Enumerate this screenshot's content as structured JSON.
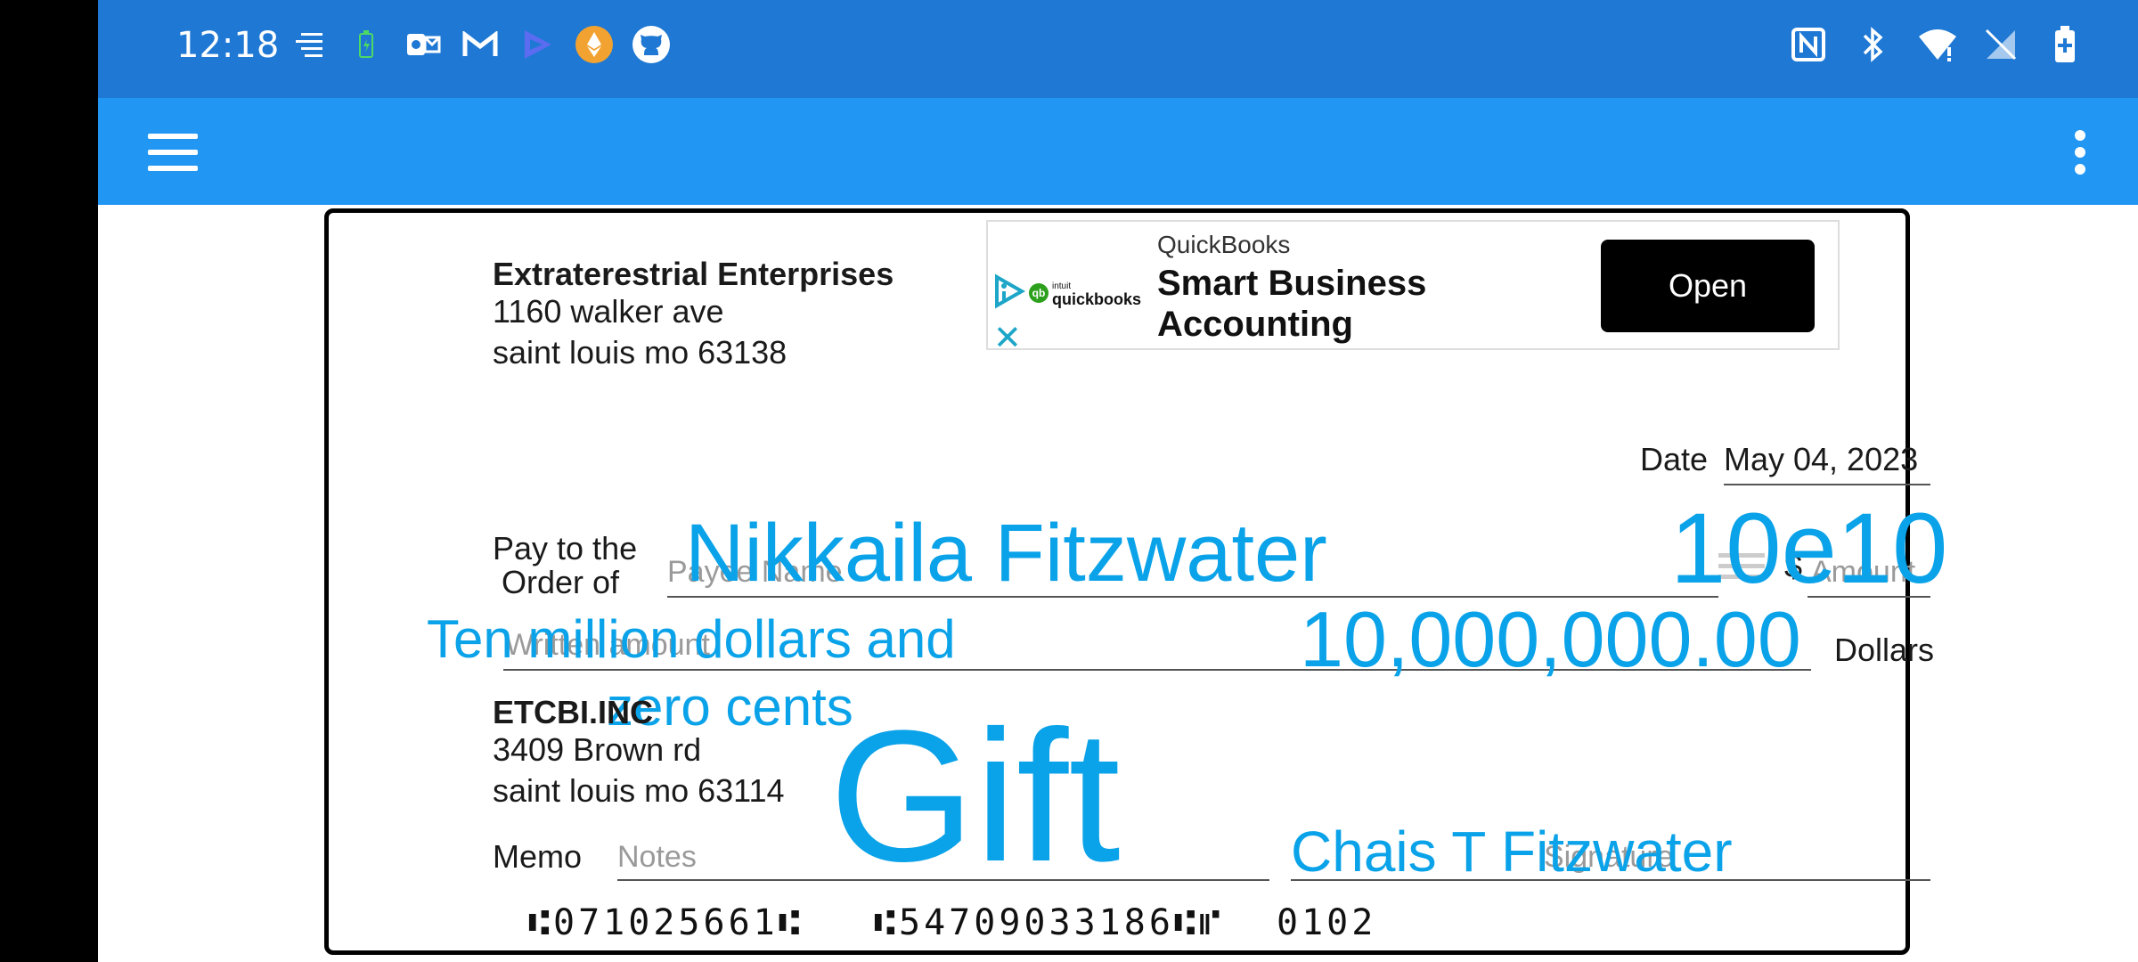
{
  "status_bar": {
    "time": "12:18",
    "left_icons": [
      "news-icon",
      "battery-saver-icon",
      "outlook-icon",
      "gmail-icon",
      "app-icon",
      "ethereum-icon",
      "github-icon"
    ],
    "right_icons": [
      "nfc-icon",
      "bluetooth-icon",
      "wifi-icon",
      "no-sim-icon",
      "battery-icon"
    ]
  },
  "app_bar": {
    "menu_icon": "hamburger-menu-icon",
    "overflow_icon": "more-vert-icon"
  },
  "ad": {
    "advertiser": "QuickBooks",
    "headline_1": "Smart Business",
    "headline_2": "Accounting",
    "button_label": "Open",
    "logo_text": "quickbooks",
    "logo_badge": "qb",
    "logo_small": "intuit",
    "close_glyph": "✕"
  },
  "check": {
    "drawer": {
      "name": "Extraterestrial Enterprises",
      "street": "1160 walker ave",
      "city": "saint louis mo 63138"
    },
    "date_label": "Date",
    "date_value": "May 04, 2023",
    "pay_to_label_1": "Pay to the",
    "pay_to_label_2": "Order of",
    "payee_placeholder": "Payee Name",
    "payee_handwritten": "Nikkaila Fitzwater",
    "amount_currency": "$",
    "amount_placeholder": "Amount",
    "amount_handwritten": "10e10",
    "written_placeholder": "Written amount",
    "written_handwritten_1": "Ten million dollars and",
    "written_handwritten_2": "zero cents",
    "written_numeric_handwritten": "10,000,000.00",
    "dollars_label": "Dollars",
    "bank": {
      "name": "ETCBI.INC",
      "street": "3409 Brown rd",
      "city": "saint louis mo 63114"
    },
    "memo_label": "Memo",
    "memo_placeholder": "Notes",
    "memo_handwritten": "Gift",
    "signature_placeholder": "Signature",
    "signature_handwritten": "Chais T Fitzwater",
    "micr_routing": "⑆071025661⑆",
    "micr_account": "⑆54709033186⑆⑈",
    "micr_check_number": "0102"
  }
}
